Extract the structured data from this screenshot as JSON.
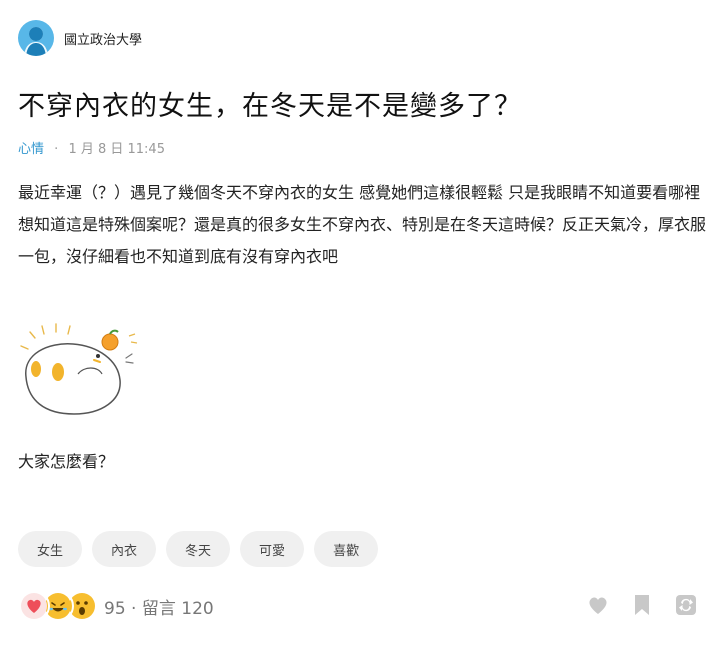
{
  "author": {
    "school": "國立政治大學"
  },
  "post": {
    "title": "不穿內衣的女生，在冬天是不是變多了？",
    "board": "心情",
    "date": "1 月 8 日 11:45",
    "paragraphs": [
      "最近幸運（？）遇見了幾個冬天不穿內衣的女生 感覺她們這樣很輕鬆 只是我眼睛不知道要看哪裡",
      "想知道這是特殊個案呢？還是真的很多女生不穿內衣、特別是在冬天這時候？反正天氣冷，厚衣服一包，沒仔細看也不知道到底有沒有穿內衣吧"
    ],
    "question": "大家怎麼看？",
    "tags": [
      "女生",
      "內衣",
      "冬天",
      "可愛",
      "喜歡"
    ]
  },
  "stats": {
    "reaction_count": "95",
    "separator": "·",
    "comments_label": "留言 120"
  },
  "colors": {
    "board": "#3397cf",
    "avatar": "#58b7e8",
    "tag_bg": "#f0f0f0"
  },
  "icons": {
    "reactions": [
      "heart-reaction-icon",
      "laugh-reaction-icon",
      "surprised-reaction-icon"
    ],
    "actions": [
      "like-heart-icon",
      "bookmark-icon",
      "share-icon"
    ]
  }
}
